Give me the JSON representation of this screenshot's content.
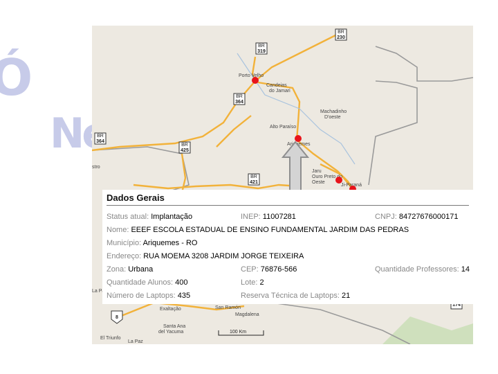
{
  "map": {
    "places": [
      {
        "name": "Porto Velho"
      },
      {
        "name": "Candeias do Jamari"
      },
      {
        "name": "Machadinho D'oeste"
      },
      {
        "name": "Alto Paraíso"
      },
      {
        "name": "Ariquemes"
      },
      {
        "name": "Jaru"
      },
      {
        "name": "Ouro Preto do Oeste"
      },
      {
        "name": "Ji-Paraná"
      },
      {
        "name": "Exaltação"
      },
      {
        "name": "San Ramón"
      },
      {
        "name": "Magdalena"
      },
      {
        "name": "Santa Ana del Yacuma"
      },
      {
        "name": "El Triunfo"
      },
      {
        "name": "La Paz"
      }
    ],
    "shields": [
      "319",
      "230",
      "364",
      "364",
      "425",
      "421",
      "174"
    ],
    "scale_label": "100 Km",
    "partial_labels": [
      "stro",
      "La Pa",
      "Ne"
    ]
  },
  "panel": {
    "title": "Dados Gerais",
    "status_label": "Status atual:",
    "status_value": "Implantação",
    "inep_label": "INEP:",
    "inep_value": "11007281",
    "cnpj_label": "CNPJ:",
    "cnpj_value": "84727676000171",
    "nome_label": "Nome:",
    "nome_value": "EEEF ESCOLA ESTADUAL DE ENSINO FUNDAMENTAL JARDIM DAS PEDRAS",
    "municipio_label": "Município:",
    "municipio_value": "Ariquemes - RO",
    "endereco_label": "Endereço:",
    "endereco_value": "RUA MOEMA 3208 JARDIM JORGE TEIXEIRA",
    "zona_label": "Zona:",
    "zona_value": "Urbana",
    "cep_label": "CEP:",
    "cep_value": "76876-566",
    "prof_label": "Quantidade Professores:",
    "prof_value": "14",
    "alunos_label": "Quantidade Alunos:",
    "alunos_value": "400",
    "lote_label": "Lote:",
    "lote_value": "2",
    "laptops_label": "Número de Laptops:",
    "laptops_value": "435",
    "reserva_label": "Reserva Técnica de Laptops:",
    "reserva_value": "21"
  },
  "colors": {
    "marker": "#e8141b",
    "road": "#f2b23a",
    "land": "#ede9e1",
    "border": "#9a9a9a",
    "decor": "#c7cbe9"
  }
}
